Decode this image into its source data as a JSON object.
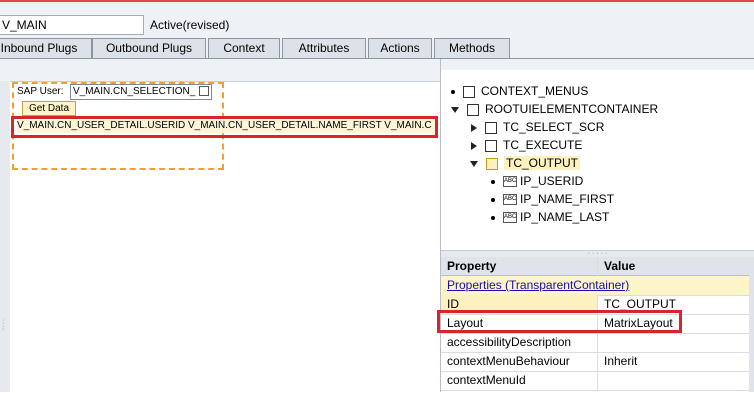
{
  "header": {
    "view_name": "V_MAIN",
    "status": "Active(revised)"
  },
  "tabs": [
    {
      "label": "Inbound Plugs",
      "active": false
    },
    {
      "label": "Outbound Plugs",
      "active": false
    },
    {
      "label": "Context",
      "active": false
    },
    {
      "label": "Attributes",
      "active": false
    },
    {
      "label": "Actions",
      "active": false
    },
    {
      "label": "Methods",
      "active": false
    }
  ],
  "layout_preview": {
    "sap_user_label": "SAP User:",
    "selection_field_value": "V_MAIN.CN_SELECTION_",
    "get_data_button": "Get Data",
    "table_row_text": "V_MAIN.CN_USER_DETAIL.USERID V_MAIN.CN_USER_DETAIL.NAME_FIRST V_MAIN.C"
  },
  "tree": {
    "items": [
      {
        "label": "CONTEXT_MENUS"
      },
      {
        "label": "ROOTUIELEMENTCONTAINER"
      },
      {
        "label": "TC_SELECT_SCR"
      },
      {
        "label": "TC_EXECUTE"
      },
      {
        "label": "TC_OUTPUT"
      },
      {
        "label": "IP_USERID"
      },
      {
        "label": "IP_NAME_FIRST"
      },
      {
        "label": "IP_NAME_LAST"
      }
    ],
    "abc_icon_text": "ABC"
  },
  "properties": {
    "col_property": "Property",
    "col_value": "Value",
    "group_label": "Properties (TransparentContainer)",
    "rows": [
      {
        "property": "ID",
        "value": "TC_OUTPUT"
      },
      {
        "property": "Layout",
        "value": "MatrixLayout"
      },
      {
        "property": "accessibilityDescription",
        "value": ""
      },
      {
        "property": "contextMenuBehaviour",
        "value": "Inherit"
      },
      {
        "property": "contextMenuId",
        "value": ""
      }
    ]
  },
  "colors": {
    "highlight_red": "#d7262b",
    "selection_orange": "#f0a030",
    "selected_node_yellow": "#fdf1c0"
  }
}
